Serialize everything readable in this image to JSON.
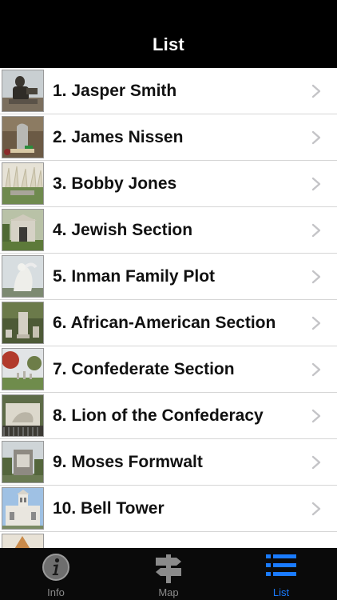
{
  "nav": {
    "title": "List"
  },
  "list": {
    "items": [
      {
        "label": "1. Jasper Smith"
      },
      {
        "label": "2. James Nissen"
      },
      {
        "label": "3. Bobby Jones"
      },
      {
        "label": "4. Jewish Section"
      },
      {
        "label": "5. Inman Family Plot"
      },
      {
        "label": "6. African-American Section"
      },
      {
        "label": "7. Confederate Section"
      },
      {
        "label": "8. Lion of the Confederacy"
      },
      {
        "label": "9. Moses Formwalt"
      },
      {
        "label": "10. Bell Tower"
      }
    ]
  },
  "tabs": {
    "info": {
      "label": "Info",
      "icon": "info-icon"
    },
    "map": {
      "label": "Map",
      "icon": "signpost-icon"
    },
    "list": {
      "label": "List",
      "icon": "list-icon"
    }
  },
  "colors": {
    "accent": "#1a7bff",
    "bar": "#000000",
    "inactive": "#8a8a8a"
  }
}
